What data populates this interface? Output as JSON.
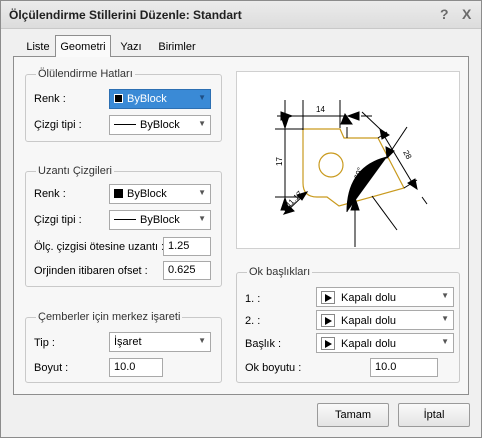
{
  "window": {
    "title": "Ölçülendirme Stillerini Düzenle: Standart",
    "help_glyph": "?",
    "close_glyph": "X"
  },
  "tabs": [
    {
      "label": "Liste",
      "active": false
    },
    {
      "label": "Geometri",
      "active": true
    },
    {
      "label": "Yazı",
      "active": false
    },
    {
      "label": "Birimler",
      "active": false
    }
  ],
  "dimension_lines": {
    "title": "Ölülendirme Hatları",
    "color_label": "Renk :",
    "color_value": "ByBlock",
    "linetype_label": "Çizgi tipi :",
    "linetype_value": "ByBlock"
  },
  "extension_lines": {
    "title": "Uzantı Çizgileri",
    "color_label": "Renk :",
    "color_value": "ByBlock",
    "linetype_label": "Çizgi tipi :",
    "linetype_value": "ByBlock",
    "extend_label": "Ölç. çizgisi ötesine uzantı :",
    "extend_value": "1.25",
    "offset_label": "Orjinden itibaren ofset :",
    "offset_value": "0.625"
  },
  "center_marks": {
    "title": "Çemberler için merkez işareti",
    "type_label": "Tip :",
    "type_value": "İşaret",
    "size_label": "Boyut :",
    "size_value": "10.0"
  },
  "arrowheads": {
    "title": "Ok başlıkları",
    "first_label": "1. :",
    "first_value": "Kapalı dolu",
    "second_label": "2. :",
    "second_value": "Kapalı dolu",
    "leader_label": "Başlık :",
    "leader_value": "Kapalı dolu",
    "size_label": "Ok boyutu :",
    "size_value": "10.0"
  },
  "preview": {
    "dim_top": "14",
    "dim_left": "17",
    "dim_diag": "28",
    "dim_angle": "60°",
    "dim_radius": "R11.17",
    "shape_color": "#c99a1e"
  },
  "buttons": {
    "ok": "Tamam",
    "cancel": "İptal"
  },
  "colors": {
    "focus": "#3a8ad6",
    "frame": "#8e8e8e"
  }
}
